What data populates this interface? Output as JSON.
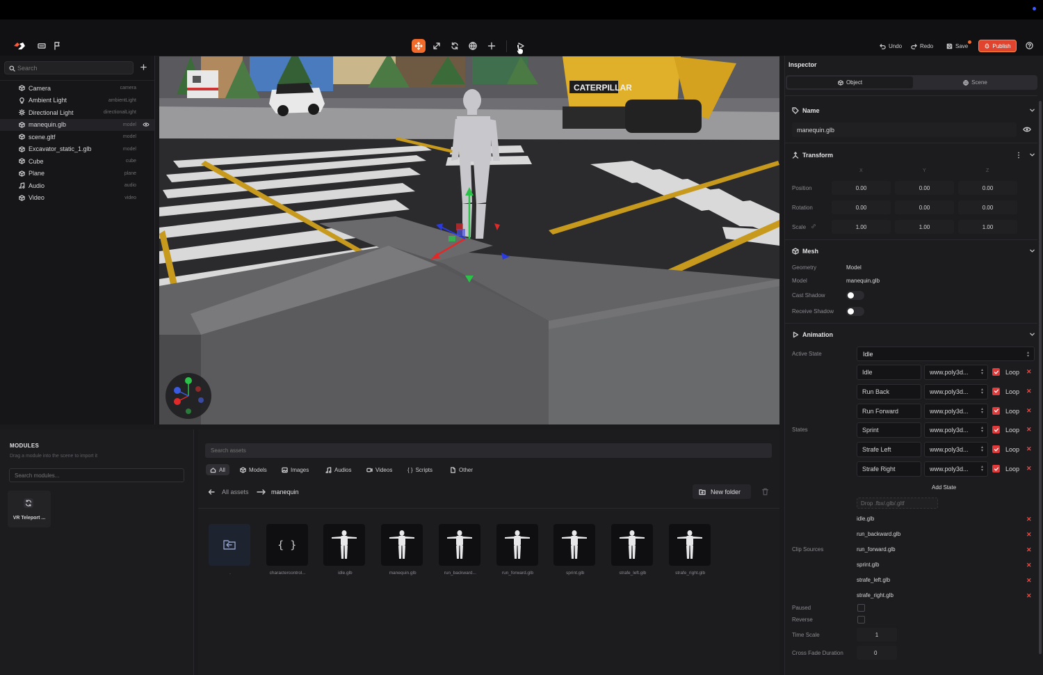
{
  "toolbar": {
    "undo_label": "Undo",
    "redo_label": "Redo",
    "save_label": "Save",
    "publish_label": "Publish",
    "accent_color": "#f26b2a"
  },
  "hierarchy": {
    "search_placeholder": "Search",
    "items": [
      {
        "name": "Camera",
        "type": "camera",
        "icon": "cube-icon"
      },
      {
        "name": "Ambient Light",
        "type": "ambientLight",
        "icon": "bulb-icon"
      },
      {
        "name": "Directional Light",
        "type": "directionalLight",
        "icon": "sun-icon"
      },
      {
        "name": "manequin.glb",
        "type": "model",
        "icon": "cube-icon"
      },
      {
        "name": "scene.gltf",
        "type": "model",
        "icon": "cube-icon"
      },
      {
        "name": "Excavator_static_1.glb",
        "type": "model",
        "icon": "cube-icon"
      },
      {
        "name": "Cube",
        "type": "cube",
        "icon": "cube-icon"
      },
      {
        "name": "Plane",
        "type": "plane",
        "icon": "cube-icon"
      },
      {
        "name": "Audio",
        "type": "audio",
        "icon": "music-icon"
      },
      {
        "name": "Video",
        "type": "video",
        "icon": "cube-icon"
      }
    ]
  },
  "viewport": {
    "sign_text": "CATERPILLAR"
  },
  "modules": {
    "title": "MODULES",
    "hint": "Drag a module into the scene to import it",
    "search_placeholder": "Search modules...",
    "items": [
      {
        "label": "VR Teleport ..."
      }
    ]
  },
  "assets": {
    "search_placeholder": "Search assets",
    "filters": [
      "All",
      "Models",
      "Images",
      "Audios",
      "Videos",
      "Scripts",
      "Other"
    ],
    "breadcrumb_root": "All assets",
    "breadcrumb_current": "manequin",
    "new_folder_label": "New folder",
    "files": [
      {
        "label": ".",
        "kind": "folder"
      },
      {
        "label": "charactercontrol...",
        "kind": "script"
      },
      {
        "label": "idle.glb",
        "kind": "model"
      },
      {
        "label": "manequin.glb",
        "kind": "model"
      },
      {
        "label": "run_backward...",
        "kind": "model"
      },
      {
        "label": "run_forward.glb",
        "kind": "model"
      },
      {
        "label": "sprint.glb",
        "kind": "model"
      },
      {
        "label": "strafe_left.glb",
        "kind": "model"
      },
      {
        "label": "strafe_right.glb",
        "kind": "model"
      }
    ]
  },
  "inspector": {
    "title": "Inspector",
    "tabs": [
      "Object",
      "Scene"
    ],
    "name_section": {
      "title": "Name",
      "value": "manequin.glb"
    },
    "transform": {
      "title": "Transform",
      "axes": [
        "X",
        "Y",
        "Z"
      ],
      "rows": [
        {
          "label": "Position",
          "values": [
            "0.00",
            "0.00",
            "0.00"
          ]
        },
        {
          "label": "Rotation",
          "values": [
            "0.00",
            "0.00",
            "0.00"
          ]
        },
        {
          "label": "Scale",
          "values": [
            "1.00",
            "1.00",
            "1.00"
          ]
        }
      ]
    },
    "mesh": {
      "title": "Mesh",
      "geometry_label": "Geometry",
      "geometry_value": "Model",
      "model_label": "Model",
      "model_value": "manequin.glb",
      "cast_shadow_label": "Cast Shadow",
      "receive_shadow_label": "Receive Shadow"
    },
    "animation": {
      "title": "Animation",
      "active_state_label": "Active State",
      "active_state_value": "Idle",
      "states_label": "States",
      "states": [
        {
          "name": "Idle",
          "source": "www.poly3d...",
          "loop": "Loop"
        },
        {
          "name": "Run Back",
          "source": "www.poly3d...",
          "loop": "Loop"
        },
        {
          "name": "Run Forward",
          "source": "www.poly3d...",
          "loop": "Loop"
        },
        {
          "name": "Sprint",
          "source": "www.poly3d...",
          "loop": "Loop"
        },
        {
          "name": "Strafe Left",
          "source": "www.poly3d...",
          "loop": "Loop"
        },
        {
          "name": "Strafe Right",
          "source": "www.poly3d...",
          "loop": "Loop"
        }
      ],
      "add_state_label": "Add State",
      "drop_placeholder": "Drop .fbx/.glb/.gltf",
      "clip_sources_label": "Clip Sources",
      "clips": [
        "idle.glb",
        "run_backward.glb",
        "run_forward.glb",
        "sprint.glb",
        "strafe_left.glb",
        "strafe_right.glb"
      ],
      "paused_label": "Paused",
      "reverse_label": "Reverse",
      "time_scale_label": "Time Scale",
      "time_scale_value": "1",
      "cross_fade_label": "Cross Fade Duration",
      "cross_fade_value": "0"
    }
  }
}
